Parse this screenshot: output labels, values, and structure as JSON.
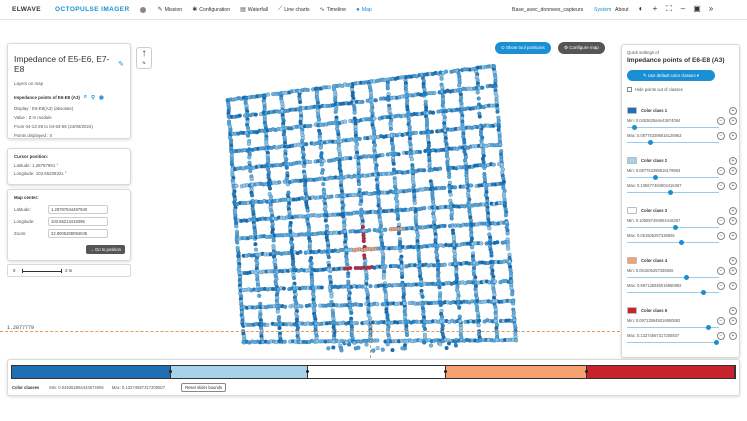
{
  "header": {
    "brand": "ELWAVE",
    "app": "OCTOPULSE IMAGER",
    "nav": [
      {
        "label": "Mission",
        "icon": "✎",
        "active": false
      },
      {
        "label": "Configuration",
        "icon": "✱",
        "active": false
      },
      {
        "label": "Waterfall",
        "icon": "▤",
        "active": false
      },
      {
        "label": "Line charts",
        "icon": "⟋",
        "active": false
      },
      {
        "label": "Timeline",
        "icon": "∿",
        "active": false
      },
      {
        "label": "Map",
        "icon": "●",
        "active": true
      }
    ],
    "dataset": "Base_avec_donnees_capteurs",
    "system": "System",
    "about": "About"
  },
  "info_panel": {
    "title": "Impedance of E5-E6, E7-E8",
    "layers_label": "Layers on map",
    "layer_title": "Impedance points of E6-E8 (A3)",
    "details": [
      "Display : E6-E8(A3) (absolute)",
      "Value : Z m module",
      "From 04-13-28 to 04-53-55 (24/09/2024)",
      "Points displayed : 0"
    ]
  },
  "cursor_panel": {
    "title": "Cursor position:",
    "latitude": "Latitude: 1.28787991 °",
    "longitude": "Longitude: 103.6520632x °"
  },
  "map_center": {
    "title": "Map center:",
    "latitude_label": "Latitude:",
    "latitude_value": "1.28787944497940",
    "longitude_label": "Longitude:",
    "longitude_value": "103.65213419395",
    "zoom_label": "Zoom:",
    "zoom_value": "22.9005208094045",
    "go_button": "→ Go to position"
  },
  "scale": {
    "zero": "0",
    "label": "2 m"
  },
  "north": {
    "arrow": "↑",
    "label": "N"
  },
  "map_buttons": {
    "tool_positions": "⊙ Show tool positions",
    "configure": "⚙ Configure map"
  },
  "coords": {
    "lat_readout": "1.2877779"
  },
  "quick_settings": {
    "label": "Quick settings of",
    "title": "Impedance points of E6-E8 (A3)",
    "default_button": "✎ Use default color classes  ▾",
    "hide_points": "Hide points out of classes",
    "classes": [
      {
        "name": "Color class 1",
        "color": "#1f6fb2",
        "min": "Min: 0.0453628a4e43674094",
        "max": "Max: 0.087763395816128963",
        "min_level": 0.05,
        "max_level": 0.28
      },
      {
        "name": "Color class 2",
        "color": "#a6d3ea",
        "min": "Min: 0.087763395816179963",
        "max": "Max: 0.105677494904416367",
        "min_level": 0.28,
        "max_level": 0.5
      },
      {
        "name": "Color class 3",
        "color": "#ffffff",
        "min": "Min: 0.105587494904416367",
        "max": "Max: 0.061506257336926",
        "min_level": 0.5,
        "max_level": 0.62
      },
      {
        "name": "Color class 4",
        "color": "#f4a070",
        "min": "Min: 0.061506257336926",
        "max": "Max: 0.987135945016950882",
        "min_level": 0.62,
        "max_level": 0.86
      },
      {
        "name": "Color class 5",
        "color": "#c8232c",
        "min": "Min: 0.097135945016950882",
        "max": "Max: 0.13274567317205507",
        "min_level": 0.86,
        "max_level": 1.0
      }
    ]
  },
  "bottom_bar": {
    "label": "Color classes",
    "min": "Min: 0.045362864443674094",
    "max": "Max: 0.13274567317205507",
    "reset": "Reset slider bounds",
    "segments": [
      {
        "color": "#1f6fb2",
        "fraction": 0.22
      },
      {
        "color": "#a6d3ea",
        "fraction": 0.19
      },
      {
        "color": "#ffffff",
        "fraction": 0.19
      },
      {
        "color": "#f4a070",
        "fraction": 0.195
      },
      {
        "color": "#c8232c",
        "fraction": 0.205
      }
    ]
  }
}
